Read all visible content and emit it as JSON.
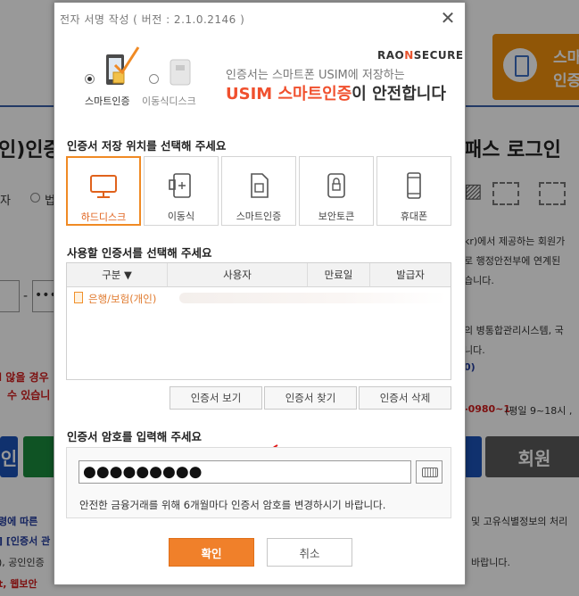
{
  "background": {
    "headline_left": "인)인증",
    "headline_right": "패스 로그인",
    "radio_label_1": "자",
    "radio_label_2": "법",
    "banner_line1": "스마",
    "banner_line2": "인증",
    "dash": "-",
    "dots": "••••••",
    "red_line1": "l 않을 경우",
    "red_line2": "수 있습니",
    "right_text_1": "kr)에서 제공하는 회원가",
    "right_text_2": "로 행정안전부에 연계된",
    "right_text_3": "습니다.",
    "right_text_4": "의 병통합관리시스템, 국",
    "right_text_5": "니다.",
    "right_text_6": "0)",
    "right_text_7": "-0980~1",
    "right_text_8": "(평일 9~18시 ,",
    "btn_left": "인",
    "btn_right": "회원",
    "bottom_1": "령에 따른",
    "bottom_2": "] [인증서 관",
    "bottom_3": "), 공인인증",
    "bottom_4": "t, 웹보안",
    "bottom_right_1": "및 고유식별정보의 처리",
    "bottom_right_2": "바랍니다."
  },
  "dialog": {
    "title": "전자 서명 작성 ( 버전 : 2.1.0.2146 )",
    "close_symbol": "✕",
    "storage_options": [
      {
        "label": "스마트인증",
        "selected": true
      },
      {
        "label": "이동식디스크",
        "selected": false
      }
    ],
    "brand_prefix": "RAO",
    "brand_n": "N",
    "brand_suffix": "SECURE",
    "promo_line1": "인증서는 스마트폰 USIM에 저장하는",
    "promo_line2_highlight": "USIM 스마트인증",
    "promo_line2_rest": "이 안전합니다",
    "location_section_title": "인증서 저장 위치를 선택해 주세요",
    "locations": [
      {
        "label": "하드디스크",
        "icon": "monitor-icon",
        "selected": true
      },
      {
        "label": "이동식",
        "icon": "usb-icon",
        "selected": false
      },
      {
        "label": "스마트인증",
        "icon": "sim-card-icon",
        "selected": false
      },
      {
        "label": "보안토큰",
        "icon": "security-token-icon",
        "selected": false
      },
      {
        "label": "휴대폰",
        "icon": "mobile-phone-icon",
        "selected": false
      }
    ],
    "cert_section_title": "사용할 인증서를 선택해 주세요",
    "table_headers": [
      "구분 ▼",
      "사용자",
      "만료일",
      "발급자"
    ],
    "rows": [
      {
        "type": "은행/보험(개인)"
      }
    ],
    "cert_buttons": [
      "인증서 보기",
      "인증서 찾기",
      "인증서 삭제"
    ],
    "password_section_title": "인증서 암호를 입력해 주세요",
    "password_value": "●●●●●●●●●",
    "password_note": "안전한 금융거래를 위해 6개월마다 인증서 암호를 변경하시기 바랍니다.",
    "ok_label": "확인",
    "cancel_label": "취소"
  },
  "colors": {
    "accent_orange": "#f0802a",
    "brand_red": "#f0502e",
    "annotation_red": "#e01818"
  }
}
